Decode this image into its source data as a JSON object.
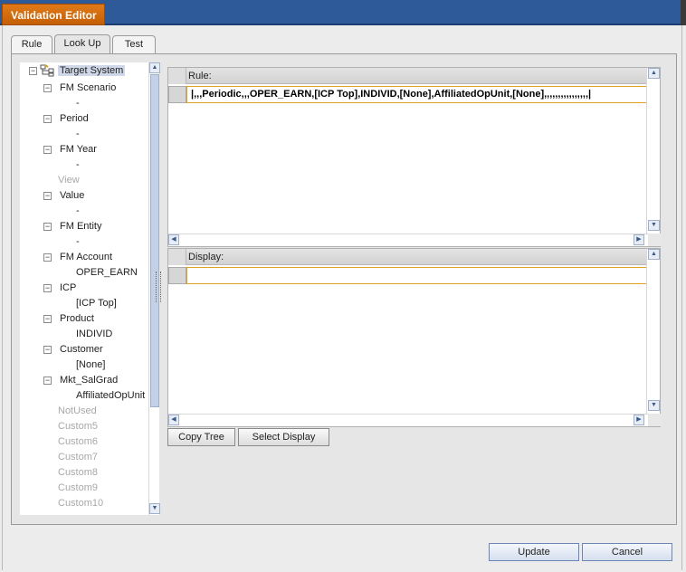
{
  "window": {
    "title": "Validation Editor"
  },
  "tabs": [
    {
      "label": "Rule",
      "active": false
    },
    {
      "label": "Look Up",
      "active": true
    },
    {
      "label": "Test",
      "active": false
    }
  ],
  "tree": {
    "root": "Target System",
    "nodes": [
      {
        "label": "FM Scenario",
        "value": "-"
      },
      {
        "label": "Period",
        "value": "-"
      },
      {
        "label": "FM Year",
        "value": "-"
      },
      {
        "label": "View",
        "disabled": true
      },
      {
        "label": "Value",
        "value": "-"
      },
      {
        "label": "FM Entity",
        "value": "-"
      },
      {
        "label": "FM Account",
        "value": "OPER_EARN"
      },
      {
        "label": "ICP",
        "value": "[ICP Top]"
      },
      {
        "label": "Product",
        "value": "INDIVID"
      },
      {
        "label": "Customer",
        "value": "[None]"
      },
      {
        "label": "Mkt_SalGrad",
        "value": "AffiliatedOpUnit"
      },
      {
        "label": "NotUsed",
        "disabled": true
      },
      {
        "label": "Custom5",
        "disabled": true
      },
      {
        "label": "Custom6",
        "disabled": true
      },
      {
        "label": "Custom7",
        "disabled": true
      },
      {
        "label": "Custom8",
        "disabled": true
      },
      {
        "label": "Custom9",
        "disabled": true
      },
      {
        "label": "Custom10",
        "disabled": true
      }
    ]
  },
  "rule_pane": {
    "header": "Rule:",
    "value": "|,,,Periodic,,,OPER_EARN,[ICP Top],INDIVID,[None],AffiliatedOpUnit,[None],,,,,,,,,,,,,,,,|"
  },
  "display_pane": {
    "header": "Display:",
    "value": ""
  },
  "buttons": {
    "copy_tree": "Copy Tree",
    "select_display": "Select Display",
    "update": "Update",
    "cancel": "Cancel"
  }
}
